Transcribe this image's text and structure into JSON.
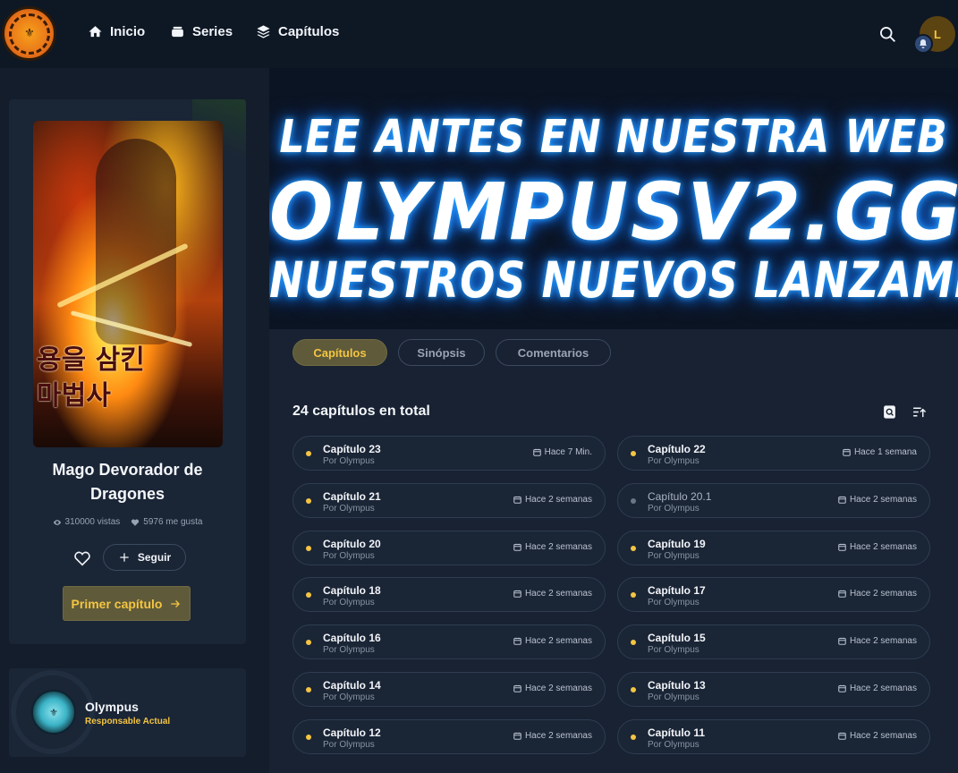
{
  "nav": {
    "inicio": "Inicio",
    "series": "Series",
    "capitulos": "Capítulos"
  },
  "user": {
    "initial": "L"
  },
  "series": {
    "title_line1": "Mago Devorador de",
    "title_line2": "Dragones",
    "views": "310000 vistas",
    "likes": "5976 me gusta",
    "follow_label": "Seguir",
    "first_chapter_label": "Primer capítulo"
  },
  "owner": {
    "name": "Olympus",
    "role": "Responsable Actual"
  },
  "banner": {
    "line1": "LEE ANTES EN NUESTRA WEB",
    "line2": "OLYMPUSV2.GG",
    "line3": "NUESTROS NUEVOS LANZAMIENTOS"
  },
  "tabs": [
    "Capítulos",
    "Sinópsis",
    "Comentarios"
  ],
  "chapters_total": "24 capítulos en total",
  "chapters": [
    {
      "name": "Capítulo 23",
      "by": "Por Olympus",
      "time": "Hace 7 Min.",
      "read": false
    },
    {
      "name": "Capítulo 22",
      "by": "Por Olympus",
      "time": "Hace 1 semana",
      "read": false
    },
    {
      "name": "Capítulo 21",
      "by": "Por Olympus",
      "time": "Hace 2 semanas",
      "read": false
    },
    {
      "name": "Capítulo 20.1",
      "by": "Por Olympus",
      "time": "Hace 2 semanas",
      "read": true
    },
    {
      "name": "Capítulo 20",
      "by": "Por Olympus",
      "time": "Hace 2 semanas",
      "read": false
    },
    {
      "name": "Capítulo 19",
      "by": "Por Olympus",
      "time": "Hace 2 semanas",
      "read": false
    },
    {
      "name": "Capítulo 18",
      "by": "Por Olympus",
      "time": "Hace 2 semanas",
      "read": false
    },
    {
      "name": "Capítulo 17",
      "by": "Por Olympus",
      "time": "Hace 2 semanas",
      "read": false
    },
    {
      "name": "Capítulo 16",
      "by": "Por Olympus",
      "time": "Hace 2 semanas",
      "read": false
    },
    {
      "name": "Capítulo 15",
      "by": "Por Olympus",
      "time": "Hace 2 semanas",
      "read": false
    },
    {
      "name": "Capítulo 14",
      "by": "Por Olympus",
      "time": "Hace 2 semanas",
      "read": false
    },
    {
      "name": "Capítulo 13",
      "by": "Por Olympus",
      "time": "Hace 2 semanas",
      "read": false
    },
    {
      "name": "Capítulo 12",
      "by": "Por Olympus",
      "time": "Hace 2 semanas",
      "read": false
    },
    {
      "name": "Capítulo 11",
      "by": "Por Olympus",
      "time": "Hace 2 semanas",
      "read": false
    }
  ],
  "colors": {
    "accent": "#f4c542",
    "background": "#131d2c",
    "card": "#1a2536"
  }
}
